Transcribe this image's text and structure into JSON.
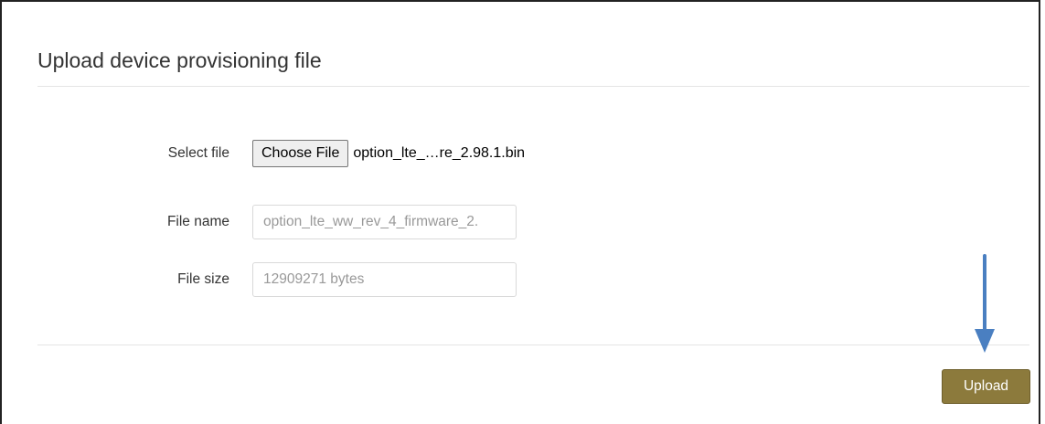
{
  "panel": {
    "title": "Upload device provisioning file"
  },
  "form": {
    "select_file": {
      "label": "Select file",
      "button_label": "Choose File",
      "chosen_file": "option_lte_…re_2.98.1.bin"
    },
    "file_name": {
      "label": "File name",
      "value": "option_lte_ww_rev_4_firmware_2."
    },
    "file_size": {
      "label": "File size",
      "value": "12909271 bytes"
    }
  },
  "actions": {
    "upload_label": "Upload"
  },
  "colors": {
    "upload_button": "#8c7a3c",
    "arrow": "#4a7fc1"
  },
  "annotation": {
    "icon": "arrow-down-icon"
  }
}
